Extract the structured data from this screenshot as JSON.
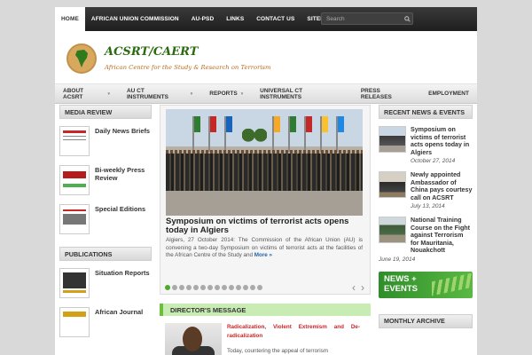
{
  "topnav": {
    "items": [
      "HOME",
      "AFRICAN UNION COMMISSION",
      "AU-PSD",
      "LINKS",
      "CONTACT US",
      "SITEMAP"
    ],
    "search_placeholder": "Search"
  },
  "header": {
    "title": "ACSRT/CAERT",
    "subtitle": "African Centre for the Study & Research on Terrorism"
  },
  "mainnav": {
    "items": [
      "ABOUT ACSRT",
      "AU CT INSTRUMENTS",
      "REPORTS",
      "UNIVERSAL CT INSTRUMENTS",
      "PRESS RELEASES",
      "EMPLOYMENT"
    ]
  },
  "media_review": {
    "heading": "MEDIA REVIEW",
    "items": [
      "Daily News Briefs",
      "Bi-weekly Press Review",
      "Special Editions"
    ]
  },
  "publications": {
    "heading": "PUBLICATIONS",
    "items": [
      "Situation Reports",
      "African Journal"
    ]
  },
  "slider": {
    "title": "Symposium on victims of terrorist acts opens today in Algiers",
    "text": "Algiers, 27 October 2014: The Commission of the African Union (AU) is convening a two-day Symposium on victims of terrorist acts at the facilities of the African Centre of the Study and",
    "more": "More »",
    "prev": "‹",
    "next": "›"
  },
  "directors_message": {
    "heading": "DIRECTOR'S MESSAGE",
    "link": "Radicalization, Violent Extremism and De-radicalization",
    "text": "Today, countering the appeal of terrorism"
  },
  "recent_news": {
    "heading": "RECENT NEWS & EVENTS",
    "items": [
      {
        "title": "Symposium on victims of terrorist acts opens today in Algiers",
        "date": "October 27, 2014"
      },
      {
        "title": "Newly appointed Ambassador of China pays courtesy call on ACSRT",
        "date": "July 13, 2014"
      },
      {
        "title": "National Training Course on the Fight against Terrorism for Mauritania, Nouakchott",
        "date": "June 19, 2014"
      }
    ],
    "banner_line1": "NEWS +",
    "banner_line2": "EVENTS"
  },
  "monthly_archive": {
    "heading": "MONTHLY ARCHIVE"
  }
}
